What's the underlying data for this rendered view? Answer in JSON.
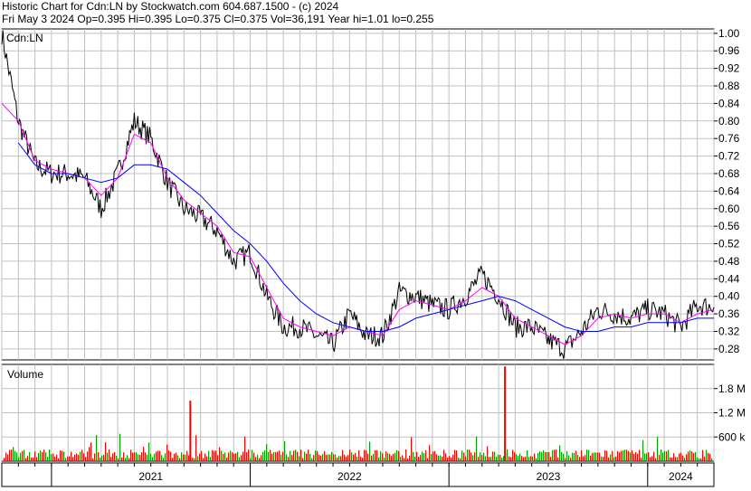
{
  "header": {
    "line1": "Historic Chart for Cdn:LN by Stockwatch.com 604.687.1500 - (c) 2024",
    "line2": "Fri May  3 2024  Op=0.395  Hi=0.395  Lo=0.375  Cl=0.375  Vol=36,191  Year hi=1.01  lo=0.255"
  },
  "colors": {
    "grid": "#c0c0c0",
    "price": "#000000",
    "ma_short": "#ff00ff",
    "ma_long": "#0000ff",
    "vol_up": "#00a000",
    "vol_down": "#ff0000"
  },
  "chart_data": [
    {
      "type": "line",
      "panel": "price",
      "title": "Cdn:LN",
      "ylim": [
        0.255,
        1.01
      ],
      "y_ticks": [
        "1.00",
        "0.96",
        "0.92",
        "0.88",
        "0.84",
        "0.80",
        "0.76",
        "0.72",
        "0.68",
        "0.64",
        "0.60",
        "0.56",
        "0.52",
        "0.48",
        "0.44",
        "0.40",
        "0.36",
        "0.32",
        "0.28"
      ],
      "x_labels": [
        "2021",
        "2022",
        "2023",
        "2024"
      ],
      "x_range": [
        "2020-10",
        "2024-05"
      ],
      "grid": true,
      "series": [
        {
          "role": "price",
          "x": [
            "2020-10",
            "2020-11",
            "2020-12",
            "2021-01",
            "2021-02",
            "2021-03",
            "2021-04",
            "2021-05",
            "2021-06",
            "2021-07",
            "2021-08",
            "2021-09",
            "2021-10",
            "2021-11",
            "2021-12",
            "2022-01",
            "2022-02",
            "2022-03",
            "2022-04",
            "2022-05",
            "2022-06",
            "2022-07",
            "2022-08",
            "2022-09",
            "2022-10",
            "2022-11",
            "2022-12",
            "2023-01",
            "2023-02",
            "2023-03",
            "2023-04",
            "2023-05",
            "2023-06",
            "2023-07",
            "2023-08",
            "2023-09",
            "2023-10",
            "2023-11",
            "2023-12",
            "2024-01",
            "2024-02",
            "2024-03",
            "2024-04",
            "2024-05"
          ],
          "values": [
            1.0,
            0.8,
            0.7,
            0.68,
            0.68,
            0.67,
            0.6,
            0.68,
            0.8,
            0.76,
            0.66,
            0.6,
            0.58,
            0.55,
            0.48,
            0.5,
            0.4,
            0.33,
            0.33,
            0.31,
            0.29,
            0.36,
            0.31,
            0.31,
            0.41,
            0.4,
            0.38,
            0.37,
            0.4,
            0.45,
            0.4,
            0.33,
            0.33,
            0.3,
            0.28,
            0.32,
            0.37,
            0.36,
            0.35,
            0.37,
            0.36,
            0.33,
            0.38,
            0.375
          ]
        },
        {
          "role": "ma_short",
          "x": [
            "2020-10",
            "2020-11",
            "2020-12",
            "2021-01",
            "2021-02",
            "2021-03",
            "2021-04",
            "2021-05",
            "2021-06",
            "2021-07",
            "2021-08",
            "2021-09",
            "2021-10",
            "2021-11",
            "2021-12",
            "2022-01",
            "2022-02",
            "2022-03",
            "2022-04",
            "2022-05",
            "2022-06",
            "2022-07",
            "2022-08",
            "2022-09",
            "2022-10",
            "2022-11",
            "2022-12",
            "2023-01",
            "2023-02",
            "2023-03",
            "2023-04",
            "2023-05",
            "2023-06",
            "2023-07",
            "2023-08",
            "2023-09",
            "2023-10",
            "2023-11",
            "2023-12",
            "2024-01",
            "2024-02",
            "2024-03",
            "2024-04",
            "2024-05"
          ],
          "values": [
            0.84,
            0.8,
            0.71,
            0.69,
            0.68,
            0.67,
            0.63,
            0.67,
            0.77,
            0.75,
            0.67,
            0.62,
            0.59,
            0.56,
            0.5,
            0.49,
            0.42,
            0.35,
            0.33,
            0.32,
            0.31,
            0.33,
            0.32,
            0.31,
            0.37,
            0.39,
            0.38,
            0.37,
            0.39,
            0.42,
            0.4,
            0.35,
            0.33,
            0.31,
            0.29,
            0.31,
            0.35,
            0.36,
            0.35,
            0.36,
            0.36,
            0.34,
            0.36,
            0.37
          ]
        },
        {
          "role": "ma_long",
          "x": [
            "2020-11",
            "2020-12",
            "2021-01",
            "2021-02",
            "2021-03",
            "2021-04",
            "2021-05",
            "2021-06",
            "2021-07",
            "2021-08",
            "2021-09",
            "2021-10",
            "2021-11",
            "2021-12",
            "2022-01",
            "2022-02",
            "2022-03",
            "2022-04",
            "2022-05",
            "2022-06",
            "2022-07",
            "2022-08",
            "2022-09",
            "2022-10",
            "2022-11",
            "2022-12",
            "2023-01",
            "2023-02",
            "2023-03",
            "2023-04",
            "2023-05",
            "2023-06",
            "2023-07",
            "2023-08",
            "2023-09",
            "2023-10",
            "2023-11",
            "2023-12",
            "2024-01",
            "2024-02",
            "2024-03",
            "2024-04",
            "2024-05"
          ],
          "values": [
            0.75,
            0.7,
            0.68,
            0.68,
            0.67,
            0.66,
            0.67,
            0.7,
            0.7,
            0.69,
            0.66,
            0.63,
            0.59,
            0.55,
            0.52,
            0.48,
            0.43,
            0.39,
            0.36,
            0.34,
            0.33,
            0.32,
            0.32,
            0.33,
            0.35,
            0.36,
            0.37,
            0.38,
            0.39,
            0.4,
            0.39,
            0.37,
            0.35,
            0.33,
            0.32,
            0.32,
            0.33,
            0.33,
            0.34,
            0.34,
            0.34,
            0.35,
            0.35
          ]
        }
      ]
    },
    {
      "type": "bar",
      "panel": "volume",
      "title": "Volume",
      "y_ticks": [
        "1.8 M",
        "1.2 M",
        "600 k"
      ],
      "ylim": [
        0,
        2400000
      ],
      "note_spikes": [
        {
          "x": "2021-09",
          "value": 1500000
        },
        {
          "x": "2023-04",
          "value": 2350000
        }
      ]
    }
  ]
}
